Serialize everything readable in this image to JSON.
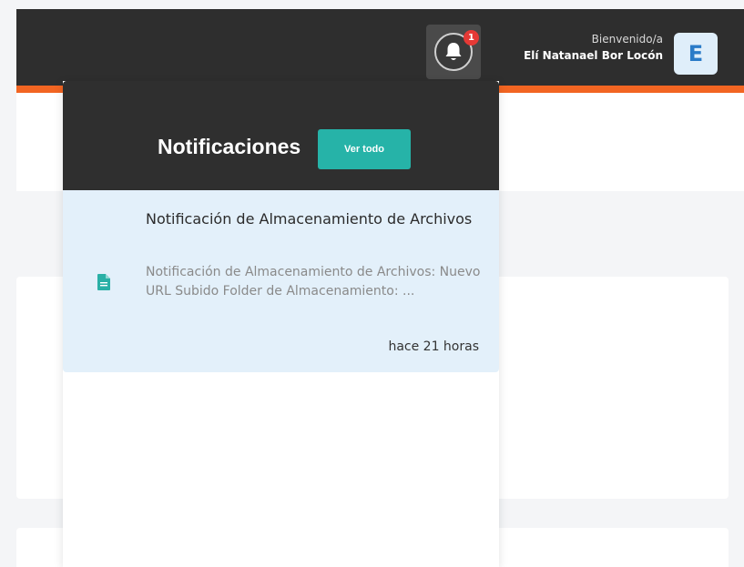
{
  "header": {
    "welcome_label": "Bienvenido/a",
    "user_name": "Elí Natanael Bor Locón",
    "avatar_initial": "E",
    "notification_count": "1"
  },
  "notifications": {
    "title": "Notificaciones",
    "view_all_label": "Ver todo",
    "items": [
      {
        "icon": "file-icon",
        "title": "Notificación de Almacenamiento de Archivos",
        "body": "Notificación de Almacenamiento de Archivos: Nuevo URL Subido Folder de Almacenamiento: ...",
        "time": "hace 21 horas"
      }
    ]
  },
  "colors": {
    "header_bg": "#2e2e2e",
    "accent_orange": "#f26522",
    "teal_button": "#26b3a8",
    "badge_red": "#e53935",
    "item_highlight": "#e3f0fa"
  }
}
